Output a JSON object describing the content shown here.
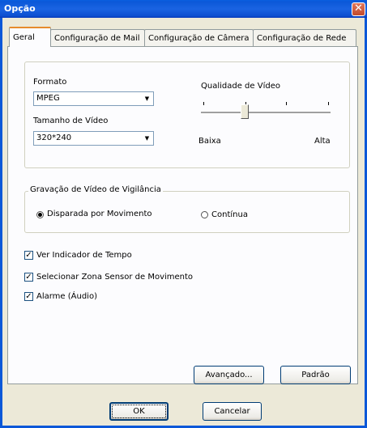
{
  "window": {
    "title": "Opção",
    "close_glyph": "✕"
  },
  "tabs": [
    {
      "label": "Geral",
      "active": true
    },
    {
      "label": "Configuração de Mail"
    },
    {
      "label": "Configuração de Câmera"
    },
    {
      "label": "Configuração de Rede"
    }
  ],
  "video": {
    "format_label": "Formato",
    "format_value": "MPEG",
    "size_label": "Tamanho de Vídeo",
    "size_value": "320*240",
    "quality_label": "Qualidade de Vídeo",
    "quality_low": "Baixa",
    "quality_high": "Alta",
    "quality_level": 0.33
  },
  "recording": {
    "group_label": "Gravação de Vídeo de Vigilância",
    "option_motion": "Disparada por Movimento",
    "option_continuous": "Contínua",
    "selected": "motion"
  },
  "options": [
    {
      "label": "Ver Indicador de Tempo",
      "checked": true
    },
    {
      "label": "Selecionar Zona Sensor de Movimento",
      "checked": true
    },
    {
      "label": "Alarme (Áudio)",
      "checked": true
    }
  ],
  "buttons": {
    "advanced": "Avançado...",
    "default": "Padrão",
    "ok": "OK",
    "cancel": "Cancelar"
  },
  "icons": {
    "dropdown": "▼",
    "check": "✓",
    "close": "close-icon"
  }
}
